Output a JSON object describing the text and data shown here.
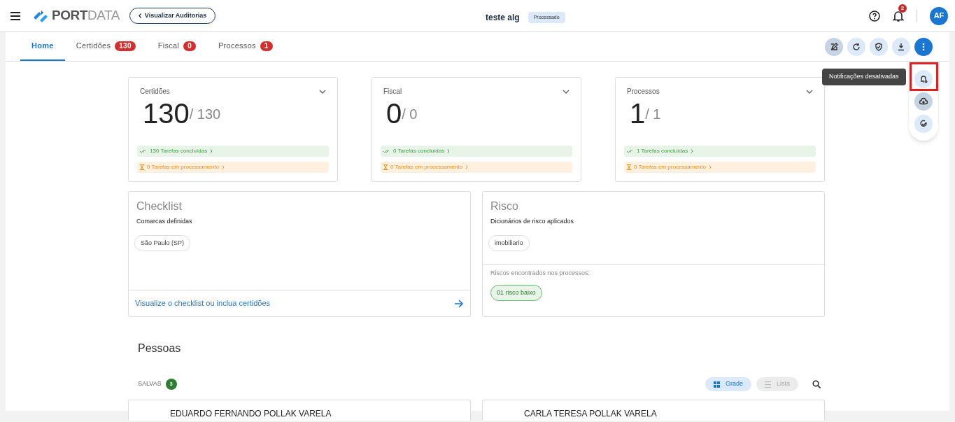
{
  "header": {
    "logo": [
      "PORT",
      "DATA"
    ],
    "back_button": "Visualizar Auditorias",
    "title": "teste alg",
    "status": "Processado",
    "notifications_count": "2",
    "avatar": "AF"
  },
  "tabs": [
    {
      "label": "Home",
      "selected": true
    },
    {
      "label": "Certidões",
      "count": "130",
      "selected": false
    },
    {
      "label": "Fiscal",
      "count": "0",
      "selected": false
    },
    {
      "label": "Processos",
      "count": "1",
      "selected": false
    }
  ],
  "tooltip": "Notificações desativadas",
  "summary_cards": [
    {
      "title": "Certidões",
      "value": "130",
      "total": "/ 130",
      "done": "130 Tarefas concluídas",
      "processing": "0 Tarefas em processamento"
    },
    {
      "title": "Fiscal",
      "value": "0",
      "total": "/ 0",
      "done": "0 Tarefas concluídas",
      "processing": "0 Tarefas em processamento"
    },
    {
      "title": "Processos",
      "value": "1",
      "total": "/ 1",
      "done": "1 Tarefas concluídas",
      "processing": "0 Tarefas em processamento"
    }
  ],
  "checklist": {
    "title": "Checklist",
    "subtitle": "Comarcas definidas",
    "chips": [
      "São Paulo (SP)"
    ],
    "link": "Visualize o checklist ou inclua certidões"
  },
  "risk": {
    "title": "Risco",
    "subtitle": "Dicionários de risco aplicados",
    "chips": [
      "imobiliario"
    ],
    "found_label": "Riscos encontrados nos processos:",
    "found_chips": [
      "01 risco baixo"
    ]
  },
  "people": {
    "title": "Pessoas",
    "saved_label": "SALVAS",
    "saved_count": "3",
    "views": [
      {
        "label": "Grade",
        "selected": true
      },
      {
        "label": "Lista",
        "selected": false
      }
    ],
    "cards": [
      "EDUARDO FERNANDO POLLAK VARELA",
      "CARLA TERESA POLLAK VARELA"
    ]
  }
}
